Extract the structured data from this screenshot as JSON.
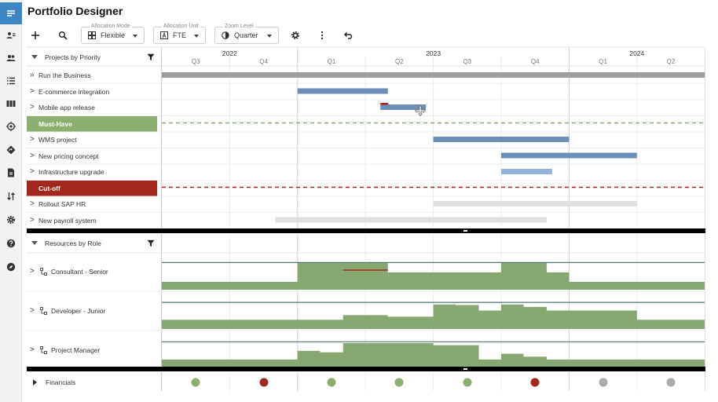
{
  "app": {
    "title": "Portfolio Designer"
  },
  "nav": {
    "items": [
      {
        "name": "menu-icon",
        "active": true
      },
      {
        "name": "person-card-icon"
      },
      {
        "name": "people-icon"
      },
      {
        "name": "list-icon"
      },
      {
        "name": "board-icon"
      },
      {
        "name": "target-icon"
      },
      {
        "name": "signpost-icon"
      },
      {
        "name": "document-icon"
      },
      {
        "name": "swap-icon"
      },
      {
        "name": "gear-icon"
      },
      {
        "name": "help-icon"
      },
      {
        "name": "compass-icon"
      }
    ]
  },
  "toolbar": {
    "allocation_mode": {
      "label": "Allocation Mode",
      "value": "Flexible"
    },
    "allocation_unit": {
      "label": "Allocation Unit",
      "value": "FTE"
    },
    "zoom_level": {
      "label": "Zoom Level",
      "value": "Quarter"
    }
  },
  "timeline": {
    "years": [
      "2022",
      "2023",
      "2024"
    ],
    "quarters": [
      "Q3",
      "Q4",
      "Q1",
      "Q2",
      "Q3",
      "Q4",
      "Q1",
      "Q2"
    ]
  },
  "projects": {
    "header": "Projects by Priority",
    "rows": [
      {
        "label": "Run the Business",
        "chevron": "»",
        "type": "project",
        "bar": {
          "start": 0,
          "end": 8,
          "color": "#9e9e9e"
        }
      },
      {
        "label": "E-commerce integration",
        "chevron": ">",
        "type": "project",
        "bar": {
          "start": 2,
          "end": 3.33,
          "color": "#6b8fb8"
        }
      },
      {
        "label": "Mobile app release",
        "chevron": ">",
        "type": "project",
        "bar": {
          "start": 3.22,
          "end": 3.89,
          "color": "#6b8fb8"
        }
      },
      {
        "label": "Must-Have",
        "chevron": "",
        "type": "band",
        "color": "#8aaf6f"
      },
      {
        "label": "WMS project",
        "chevron": ">",
        "type": "project",
        "bar": {
          "start": 4,
          "end": 6,
          "color": "#6b8fb8"
        }
      },
      {
        "label": "New pricing concept",
        "chevron": ">",
        "type": "project",
        "bar": {
          "start": 5,
          "end": 7,
          "color": "#6b8fb8"
        }
      },
      {
        "label": "Infrastructure upgrade",
        "chevron": ">",
        "type": "project",
        "bar": {
          "start": 5,
          "end": 5.75,
          "color": "#93b5dc"
        }
      },
      {
        "label": "Cut-off",
        "chevron": "",
        "type": "band",
        "color": "#a3271d"
      },
      {
        "label": "Rollout SAP HR",
        "chevron": ">",
        "type": "project",
        "bar": {
          "start": 4,
          "end": 7,
          "color": "#e0e0e0"
        }
      },
      {
        "label": "New payroll system",
        "chevron": ">",
        "type": "project",
        "bar": {
          "start": 1.67,
          "end": 5.67,
          "color": "#e0e0e0"
        }
      }
    ]
  },
  "resources": {
    "header": "Resources by Role",
    "rows": [
      {
        "label": "Consultant - Senior",
        "capacity": 0.85,
        "demand": [
          [
            0,
            0.25
          ],
          [
            2,
            0.85
          ],
          [
            2.67,
            0.87
          ],
          [
            3.33,
            0.55
          ],
          [
            4,
            0.55
          ],
          [
            5,
            0.87
          ],
          [
            5.67,
            0.55
          ],
          [
            6,
            0.25
          ]
        ]
      },
      {
        "label": "Developer - Junior",
        "capacity": 0.85,
        "demand": [
          [
            0,
            0.3
          ],
          [
            2.67,
            0.45
          ],
          [
            3.33,
            0.4
          ],
          [
            4,
            0.8
          ],
          [
            4.33,
            0.78
          ],
          [
            4.67,
            0.6
          ],
          [
            5,
            0.8
          ],
          [
            5.33,
            0.72
          ],
          [
            5.67,
            0.6
          ],
          [
            7,
            0.3
          ]
        ]
      },
      {
        "label": "Project Manager",
        "capacity": 0.85,
        "demand": [
          [
            0,
            0.25
          ],
          [
            2,
            0.55
          ],
          [
            2.33,
            0.5
          ],
          [
            2.67,
            0.82
          ],
          [
            4,
            0.75
          ],
          [
            4.67,
            0.25
          ],
          [
            5,
            0.45
          ],
          [
            5.33,
            0.35
          ],
          [
            5.67,
            0.25
          ]
        ]
      }
    ]
  },
  "financials": {
    "label": "Financials",
    "indicators": [
      {
        "quarter": "Q3 2022",
        "status": "good",
        "color": "#8aaf6f"
      },
      {
        "quarter": "Q4 2022",
        "status": "bad",
        "color": "#a3271d"
      },
      {
        "quarter": "Q1 2023",
        "status": "good",
        "color": "#8aaf6f"
      },
      {
        "quarter": "Q2 2023",
        "status": "good",
        "color": "#8aaf6f"
      },
      {
        "quarter": "Q3 2023",
        "status": "good",
        "color": "#8aaf6f"
      },
      {
        "quarter": "Q4 2023",
        "status": "bad",
        "color": "#a3271d"
      },
      {
        "quarter": "Q1 2024",
        "status": "neutral",
        "color": "#ababab"
      },
      {
        "quarter": "Q2 2024",
        "status": "neutral",
        "color": "#ababab"
      }
    ]
  },
  "colors": {
    "accent": "#3d86c6",
    "green": "#8aaf6f",
    "red": "#a3271d",
    "blue": "#6b8fb8",
    "capacity_line": "#4d7a6d"
  }
}
